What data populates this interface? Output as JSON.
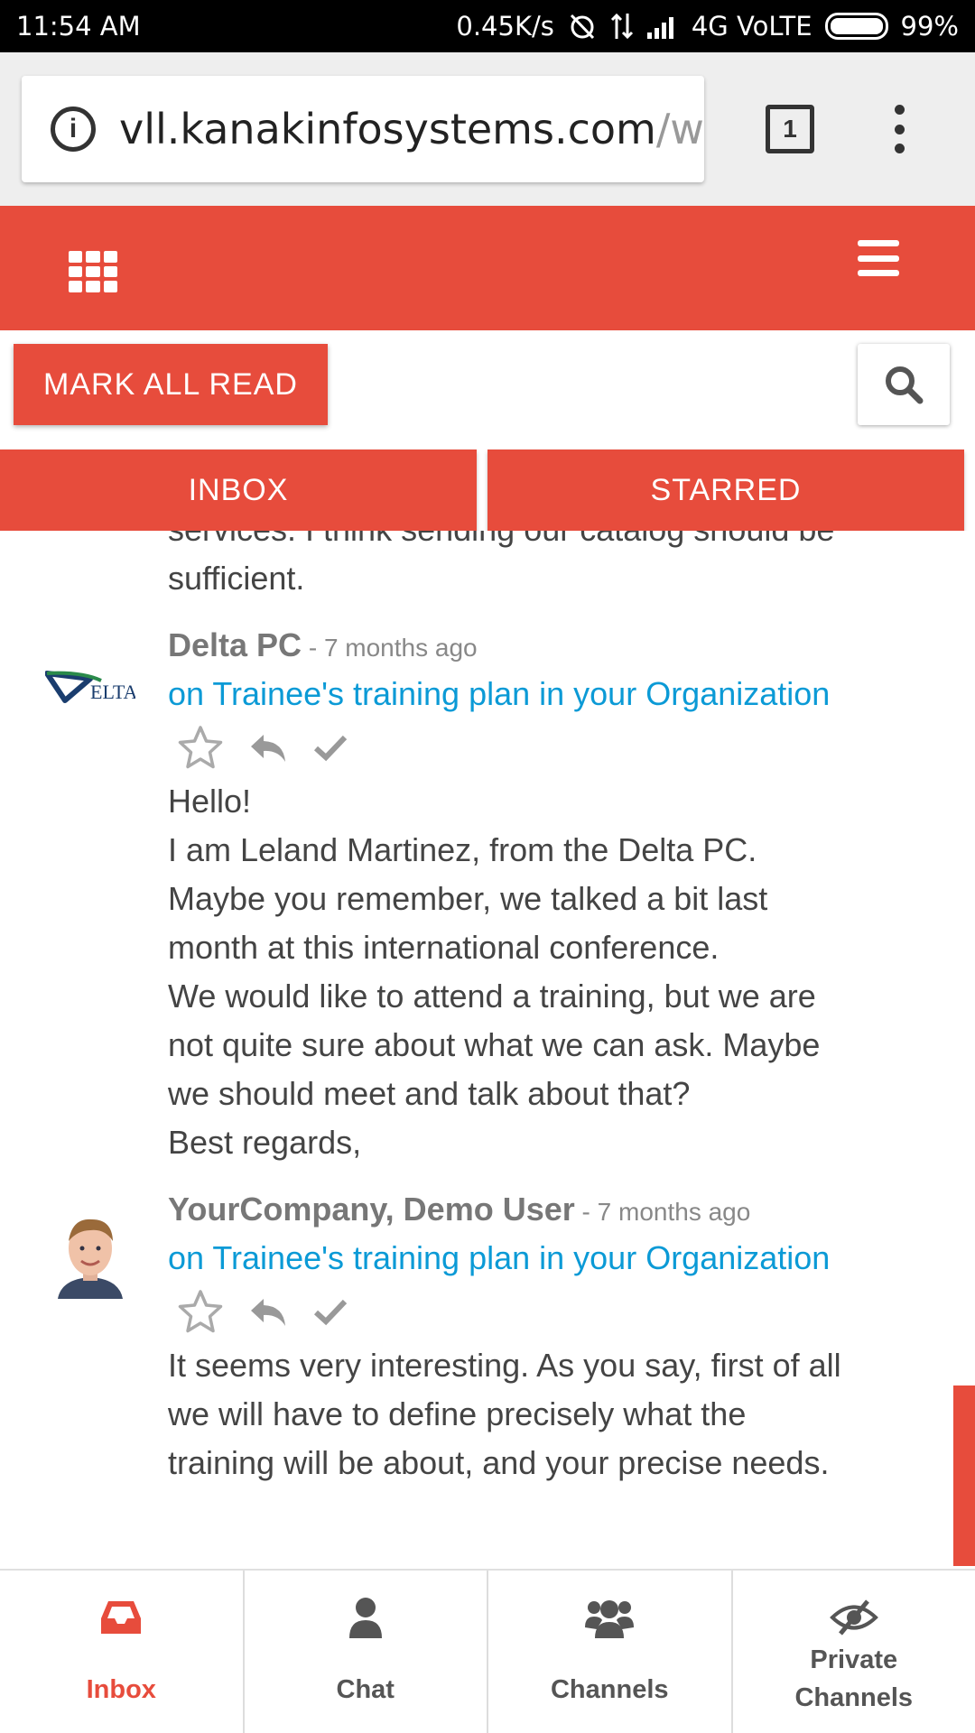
{
  "status_bar": {
    "time": "11:54 AM",
    "net_speed": "0.45K/s",
    "network": "4G VoLTE",
    "battery": "99%"
  },
  "browser": {
    "url_main": "vll.kanakinfosystems.com",
    "url_rest": "/w",
    "tab_count": "1"
  },
  "toolbar": {
    "mark_all_read": "MARK ALL READ"
  },
  "tabs": [
    {
      "label": "INBOX"
    },
    {
      "label": "STARRED"
    }
  ],
  "messages": {
    "previous_tail": [
      "services. I think sending our catalog should be",
      "sufficient."
    ],
    "items": [
      {
        "author": "Delta PC",
        "separator": " - ",
        "time_ago": "7 months ago",
        "record_link": "on Trainee's training plan in your Organization",
        "avatar": "delta-pc-logo",
        "body": [
          "Hello!",
          "I am Leland Martinez, from the Delta PC.",
          "Maybe you remember, we talked a bit last",
          "month at this international conference.",
          "We would like to attend a training, but we are",
          "not quite sure about what we can ask. Maybe",
          "we should meet and talk about that?",
          "Best regards,"
        ]
      },
      {
        "author": "YourCompany, Demo User",
        "separator": " - ",
        "time_ago": "7 months ago",
        "record_link": "on Trainee's training plan in your Organization",
        "avatar": "user-photo",
        "body": [
          "It seems very interesting. As you say, first of all",
          "we will have to define precisely what the",
          "training will be about, and your precise needs."
        ]
      }
    ]
  },
  "bottom_nav": [
    {
      "label": "Inbox",
      "icon": "inbox-tray-icon",
      "active": true
    },
    {
      "label": "Chat",
      "icon": "user-icon",
      "active": false
    },
    {
      "label": "Channels",
      "icon": "users-group-icon",
      "active": false
    },
    {
      "label_line1": "Private",
      "label_line2": "Channels",
      "icon": "eye-slash-icon",
      "active": false
    }
  ],
  "colors": {
    "accent": "#e74c3c",
    "link": "#0b9ad6",
    "text": "#444444",
    "muted": "#888888"
  }
}
